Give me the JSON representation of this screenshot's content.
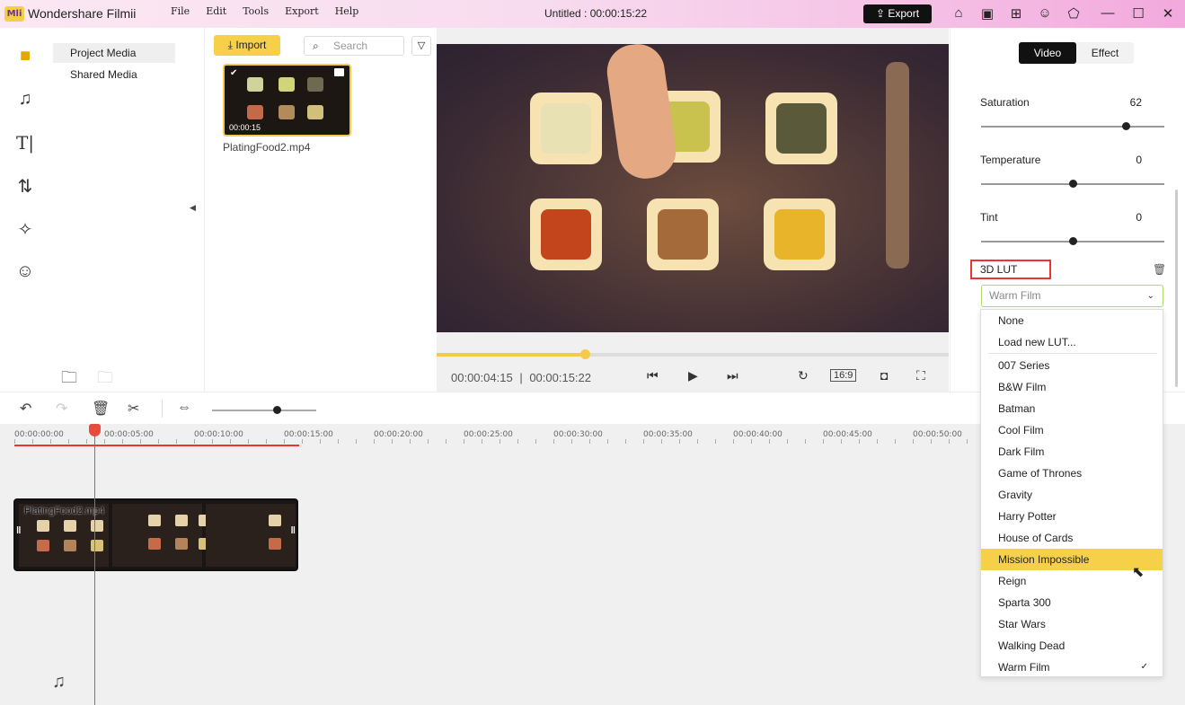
{
  "app": {
    "logo_text": "Mli",
    "name": "Wondershare Filmii",
    "menu": [
      "File",
      "Edit",
      "Tools",
      "Export",
      "Help"
    ],
    "doc_title": "Untitled :",
    "doc_time": "00:00:15:22",
    "export_label": "Export",
    "title_icons": [
      "home-icon",
      "save-icon",
      "cart-icon",
      "account-icon",
      "tshirt-icon",
      "minimize-icon",
      "maximize-icon",
      "close-icon"
    ]
  },
  "sidebar": {
    "icons": [
      "folder-icon",
      "music-icon",
      "text-icon",
      "transition-icon",
      "effects-icon",
      "sticker-icon"
    ],
    "items": [
      {
        "label": "Project Media",
        "active": true
      },
      {
        "label": "Shared Media",
        "active": false
      }
    ]
  },
  "bin": {
    "import_label": "Import",
    "search_placeholder": "Search",
    "clip": {
      "duration": "00:00:15",
      "name": "PlatingFood2.mp4"
    }
  },
  "preview": {
    "current_time": "00:00:04:15",
    "separator": "|",
    "total_time": "00:00:15:22",
    "progress": 0.29,
    "aspect_ratio": "16:9"
  },
  "properties": {
    "tabs": [
      {
        "label": "Video",
        "active": true
      },
      {
        "label": "Effect",
        "active": false
      }
    ],
    "params": [
      {
        "label": "Saturation",
        "value": "62",
        "level": 0.79
      },
      {
        "label": "Temperature",
        "value": "0",
        "level": 0.5
      },
      {
        "label": "Tint",
        "value": "0",
        "level": 0.5
      }
    ],
    "lut": {
      "label": "3D LUT",
      "selected": "Warm Film",
      "options": [
        "None",
        "Load new LUT...",
        "007 Series",
        "B&W Film",
        "Batman",
        "Cool Film",
        "Dark Film",
        "Game of Thrones",
        "Gravity",
        "Harry Potter",
        "House of Cards",
        "Mission Impossible",
        "Reign",
        "Sparta 300",
        "Star Wars",
        "Walking Dead",
        "Warm Film"
      ],
      "highlighted": "Mission Impossible",
      "checked": "Warm Film"
    }
  },
  "timeline": {
    "ticks": [
      "00:00:00:00",
      "00:00:05:00",
      "00:00:10:00",
      "00:00:15:00",
      "00:00:20:00",
      "00:00:25:00",
      "00:00:30:00",
      "00:00:35:00",
      "00:00:40:00",
      "00:00:45:00",
      "00:00:50:00"
    ],
    "clip_name": "PlatingFood2.mp4"
  },
  "colors": {
    "accent": "#f7d04a",
    "playhead": "#e84b3c",
    "highlight_border": "#e33333"
  }
}
